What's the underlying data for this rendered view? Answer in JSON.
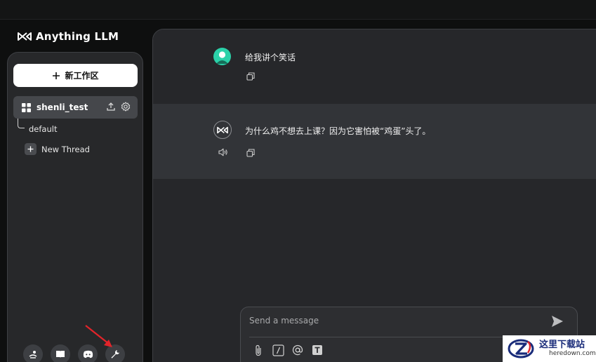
{
  "app": {
    "logo_text": "Anything LLM"
  },
  "sidebar": {
    "new_workspace_label": "新工作区",
    "workspace": {
      "name": "shenli_test"
    },
    "threads": [
      {
        "label": "default"
      }
    ],
    "new_thread_label": "New Thread",
    "footer_icons": [
      "community-hub-icon",
      "docs-book-icon",
      "discord-icon",
      "settings-wrench-icon"
    ]
  },
  "chat": {
    "messages": [
      {
        "role": "user",
        "text": "给我讲个笑话"
      },
      {
        "role": "assistant",
        "text": "为什么鸡不想去上课？因为它害怕被“鸡蛋”头了。"
      }
    ]
  },
  "composer": {
    "placeholder": "Send a message",
    "tools": [
      "attach-icon",
      "slash-command-icon",
      "mention-icon",
      "text-size-icon"
    ]
  },
  "watermark": {
    "title": "这里下载站",
    "subtitle": "heredown.com"
  },
  "colors": {
    "accent_user_avatar": "#2bd1a9",
    "arrow_red": "#e2242a",
    "background": "#0e0f0f",
    "panel": "#27282a",
    "assistant_row": "#323438"
  }
}
